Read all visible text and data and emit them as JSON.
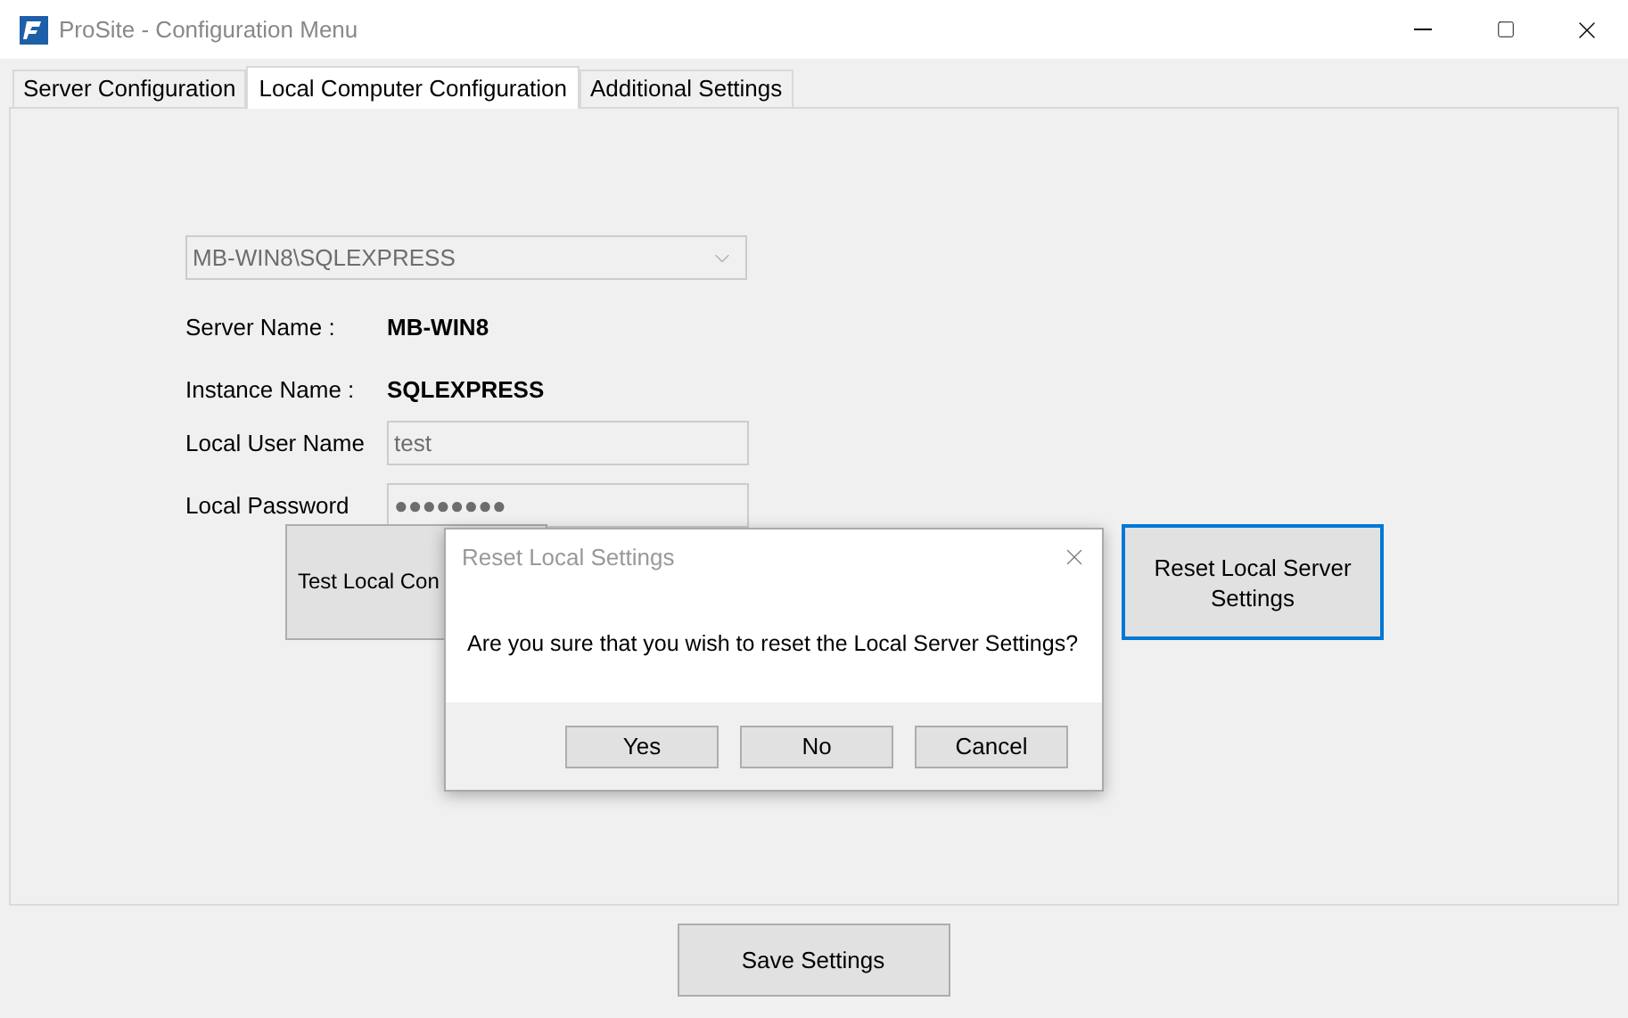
{
  "window": {
    "title": "ProSite - Configuration Menu"
  },
  "tabs": [
    {
      "label": "Server Configuration",
      "selected": false
    },
    {
      "label": "Local Computer Configuration",
      "selected": true
    },
    {
      "label": "Additional Settings",
      "selected": false
    }
  ],
  "server_select": {
    "value": "MB-WIN8\\SQLEXPRESS",
    "disabled": true
  },
  "info": [
    {
      "label": "Server Name :",
      "value": "MB-WIN8"
    },
    {
      "label": "Instance Name :",
      "value": "SQLEXPRESS"
    }
  ],
  "fields": [
    {
      "label": "Local User Name",
      "value": "test"
    },
    {
      "label": "Local Password",
      "value": "●●●●●●●●"
    }
  ],
  "buttons": [
    {
      "label": "Test Local Con",
      "focused": false
    },
    {
      "label": "Reset Local Server Settings",
      "focused": true
    }
  ],
  "save_button": "Save Settings",
  "dialog": {
    "title": "Reset Local Settings",
    "message": "Are you sure that you wish to reset the Local Server Settings?",
    "buttons": [
      "Yes",
      "No",
      "Cancel"
    ]
  }
}
